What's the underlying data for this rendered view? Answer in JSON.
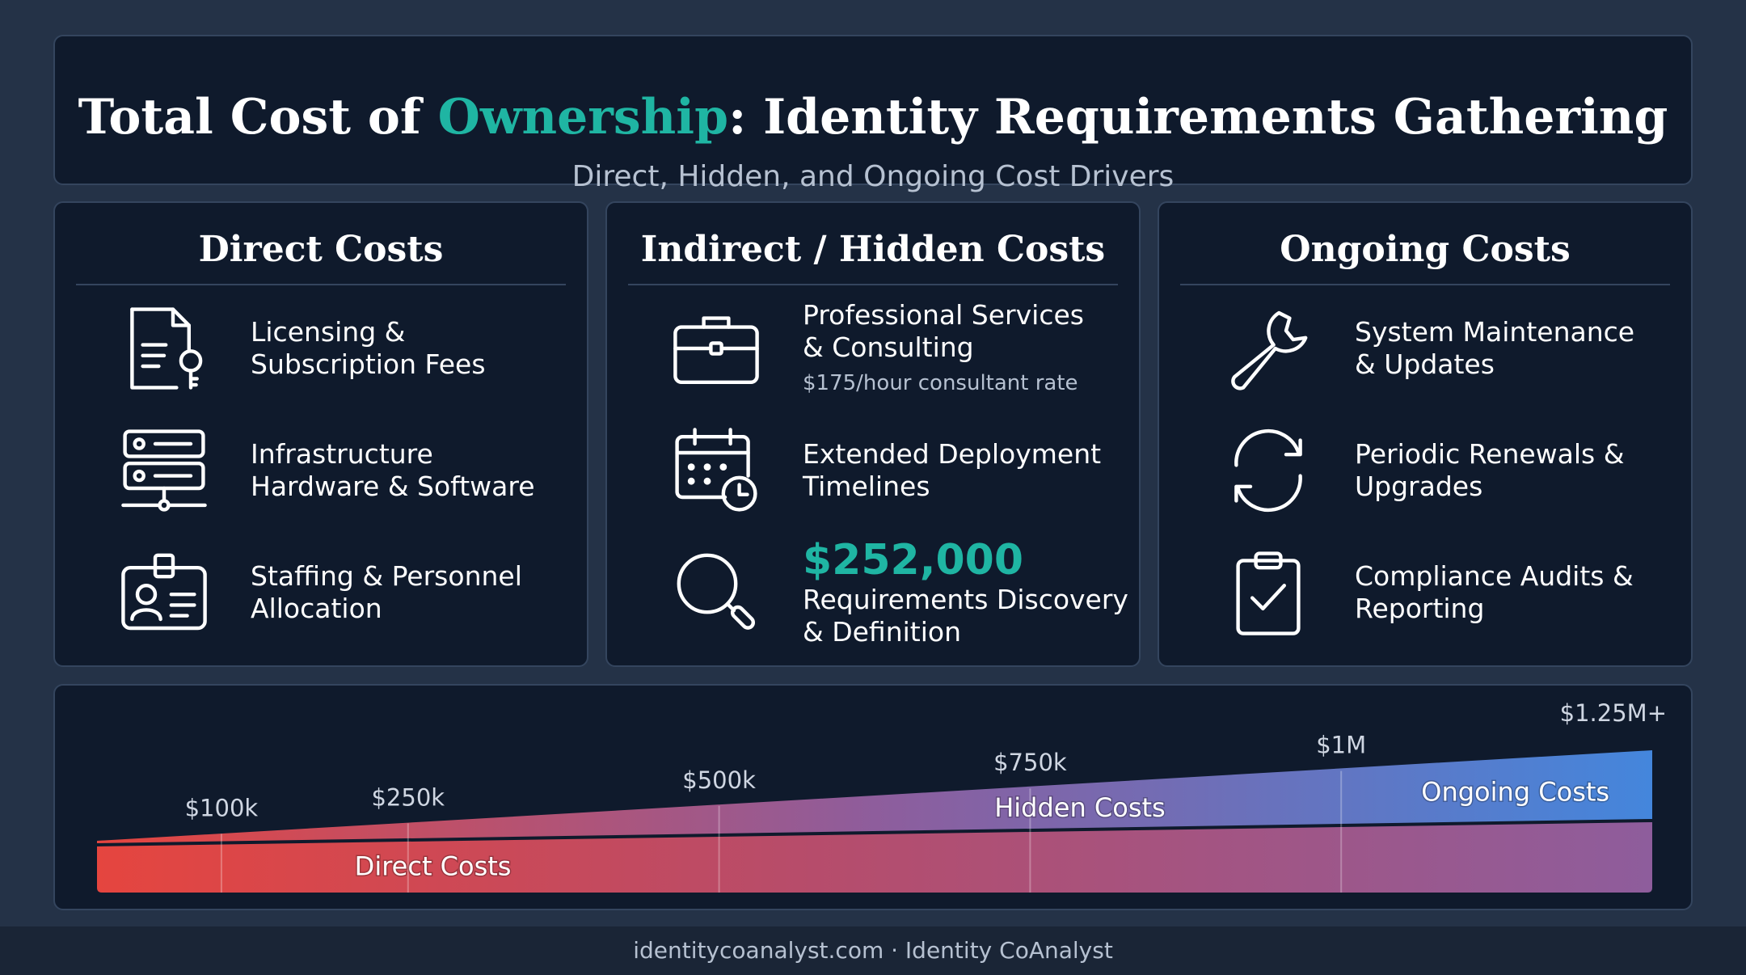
{
  "header": {
    "title_before": "Total Cost of ",
    "title_accent": "Ownership",
    "title_after": ": Identity Requirements Gathering",
    "subtitle": "Direct, Hidden, and Ongoing Cost Drivers"
  },
  "columns": [
    {
      "title": "Direct Costs",
      "items": [
        {
          "icon": "document-key-icon",
          "label": "Licensing &\nSubscription Fees"
        },
        {
          "icon": "server-icon",
          "label": "Infrastructure\nHardware & Software"
        },
        {
          "icon": "id-badge-icon",
          "label": "Staffing & Personnel\nAllocation"
        }
      ]
    },
    {
      "title": "Indirect / Hidden Costs",
      "items": [
        {
          "icon": "briefcase-icon",
          "label": "Professional Services\n& Consulting",
          "note": "$175/hour consultant rate"
        },
        {
          "icon": "calendar-clock-icon",
          "label": "Extended Deployment\nTimelines"
        },
        {
          "icon": "magnifier-icon",
          "value": "$252,000",
          "label": "Requirements Discovery\n& Definition"
        }
      ]
    },
    {
      "title": "Ongoing Costs",
      "items": [
        {
          "icon": "wrench-icon",
          "label": "System Maintenance\n& Updates"
        },
        {
          "icon": "refresh-icon",
          "label": "Periodic Renewals &\nUpgrades"
        },
        {
          "icon": "clipboard-check-icon",
          "label": "Compliance Audits &\nReporting"
        }
      ]
    }
  ],
  "chart_data": {
    "type": "area",
    "markers": [
      {
        "label": "$100k",
        "value": 100000
      },
      {
        "label": "$250k",
        "value": 250000
      },
      {
        "label": "$500k",
        "value": 500000
      },
      {
        "label": "$750k",
        "value": 750000
      },
      {
        "label": "$1M",
        "value": 1000000
      },
      {
        "label": "$1.25M+",
        "value": 1250000
      }
    ],
    "xlim": [
      0,
      1250000
    ],
    "bands": [
      {
        "name": "Direct Costs",
        "label_at": 270000
      },
      {
        "name": "Hidden Costs",
        "label_at": 790000
      },
      {
        "name": "Ongoing Costs",
        "label_at": 1140000
      }
    ],
    "colors": {
      "start": "#e5453f",
      "mid": "#8e5d9c",
      "end": "#4486dc"
    }
  },
  "footer": {
    "text": "identitycoanalyst.com · Identity CoAnalyst"
  }
}
